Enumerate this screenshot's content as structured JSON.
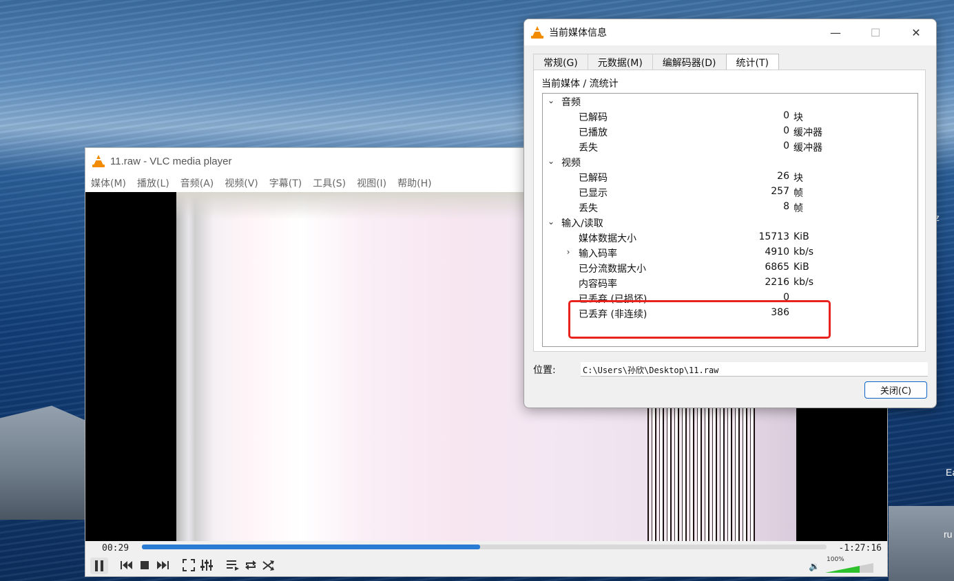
{
  "desktop": {
    "edge_texts": [
      "z",
      "Ea",
      "ru"
    ]
  },
  "vlc": {
    "title": "11.raw - VLC media player",
    "menu": [
      "媒体(M)",
      "播放(L)",
      "音频(A)",
      "视频(V)",
      "字幕(T)",
      "工具(S)",
      "视图(I)",
      "帮助(H)"
    ],
    "time_elapsed": "00:29",
    "time_remaining": "-1:27:16",
    "seek_fraction": 0.494,
    "volume_label": "100%",
    "volume_fraction": 0.72
  },
  "dialog": {
    "title": "当前媒体信息",
    "tabs": [
      "常规(G)",
      "元数据(M)",
      "编解码器(D)",
      "统计(T)"
    ],
    "active_tab": "统计(T)",
    "panel_label": "当前媒体 / 流统计",
    "groups": [
      {
        "name": "音频",
        "rows": [
          {
            "name": "已解码",
            "value": "0",
            "unit": "块"
          },
          {
            "name": "已播放",
            "value": "0",
            "unit": "缓冲器"
          },
          {
            "name": "丢失",
            "value": "0",
            "unit": "缓冲器"
          }
        ]
      },
      {
        "name": "视频",
        "rows": [
          {
            "name": "已解码",
            "value": "26",
            "unit": "块"
          },
          {
            "name": "已显示",
            "value": "257",
            "unit": "帧"
          },
          {
            "name": "丢失",
            "value": "8",
            "unit": "帧"
          }
        ]
      },
      {
        "name": "输入/读取",
        "rows": [
          {
            "name": "媒体数据大小",
            "value": "15713",
            "unit": "KiB"
          },
          {
            "name": "输入码率",
            "value": "4910",
            "unit": "kb/s"
          },
          {
            "name": "已分流数据大小",
            "value": "6865",
            "unit": "KiB"
          },
          {
            "name": "内容码率",
            "value": "2216",
            "unit": "kb/s"
          },
          {
            "name": "已丢弃 (已损坏)",
            "value": "0",
            "unit": ""
          },
          {
            "name": "已丢弃 (非连续)",
            "value": "386",
            "unit": ""
          }
        ]
      }
    ],
    "location_label": "位置:",
    "location_value": "C:\\Users\\孙欣\\Desktop\\11.raw",
    "close_label": "关闭(C)",
    "window_buttons": {
      "minimize": "—",
      "maximize": "☐",
      "close": "✕"
    }
  }
}
